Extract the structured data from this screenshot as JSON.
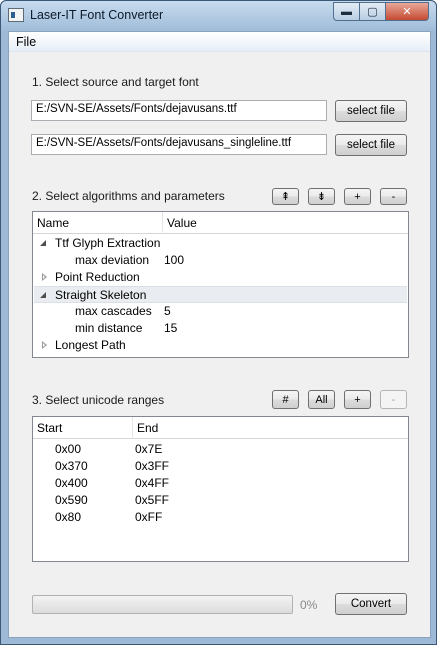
{
  "window": {
    "title": "Laser-IT Font Converter",
    "controls": {
      "minimize": "▬",
      "maximize": "▢",
      "close": "✕"
    }
  },
  "menubar": {
    "items": [
      "File"
    ]
  },
  "section1": {
    "label": "1. Select source and target font",
    "source_path": "E:/SVN-SE/Assets/Fonts/dejavusans.ttf",
    "target_path": "E:/SVN-SE/Assets/Fonts/dejavusans_singleline.ttf",
    "select_label": "select file"
  },
  "section2": {
    "label": "2. Select algorithms and parameters",
    "buttons": {
      "move_up": "⇞",
      "move_down": "⇟",
      "add": "+",
      "remove": "-"
    },
    "columns": [
      "Name",
      "Value"
    ],
    "rows": [
      {
        "name": "Ttf Glyph Extraction",
        "value": "",
        "type": "group",
        "state": "expanded"
      },
      {
        "name": "max deviation",
        "value": "100",
        "type": "param"
      },
      {
        "name": "Point Reduction",
        "value": "",
        "type": "group",
        "state": "collapsed"
      },
      {
        "name": "Straight Skeleton",
        "value": "",
        "type": "group",
        "state": "expanded",
        "selected": true
      },
      {
        "name": "max cascades",
        "value": "5",
        "type": "param"
      },
      {
        "name": "min distance",
        "value": "15",
        "type": "param"
      },
      {
        "name": "Longest Path",
        "value": "",
        "type": "group",
        "state": "collapsed"
      }
    ]
  },
  "section3": {
    "label": "3. Select unicode ranges",
    "buttons": {
      "hash": "#",
      "all": "All",
      "add": "+",
      "remove": "-"
    },
    "columns": [
      "Start",
      "End"
    ],
    "rows": [
      {
        "start": "0x00",
        "end": "0x7E"
      },
      {
        "start": "0x370",
        "end": "0x3FF"
      },
      {
        "start": "0x400",
        "end": "0x4FF"
      },
      {
        "start": "0x590",
        "end": "0x5FF"
      },
      {
        "start": "0x80",
        "end": "0xFF"
      }
    ]
  },
  "footer": {
    "progress_fraction": 0,
    "progress_text": "0%",
    "convert_label": "Convert"
  },
  "colors": {
    "progress": "#37b44a",
    "title_bar": "#9fbcd9"
  }
}
